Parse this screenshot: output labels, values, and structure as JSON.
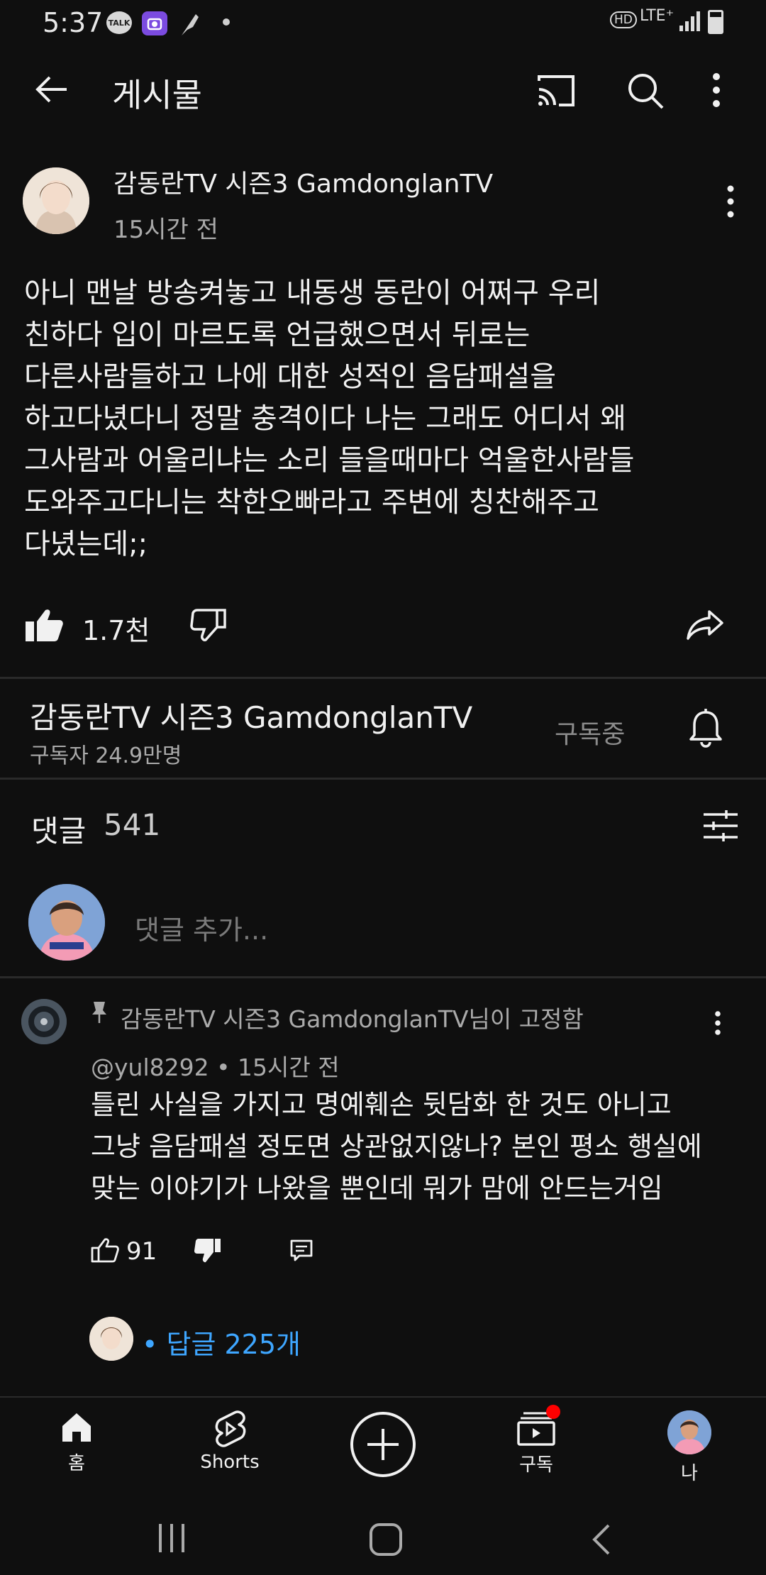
{
  "status_bar": {
    "time": "5:37",
    "talk_badge": "TALK",
    "hd": "HD",
    "network": "LTE⁺"
  },
  "top_bar": {
    "title": "게시물",
    "icons": [
      "back-arrow-icon",
      "cast-icon",
      "search-icon",
      "more-vertical-icon"
    ]
  },
  "post": {
    "channel": "감동란TV 시즌3 GamdonglanTV",
    "time": "15시간 전",
    "body": "아니 맨날 방송켜놓고 내동생 동란이 어쩌구 우리\n친하다 입이 마르도록 언급했으면서 뒤로는\n다른사람들하고 나에 대한 성적인 음담패설을\n하고다녔다니 정말 충격이다 나는 그래도 어디서 왜\n그사람과 어울리냐는 소리 들을때마다 억울한사람들\n도와주고다니는 착한오빠라고 주변에 칭찬해주고\n다녔는데;;",
    "likes": "1.7천"
  },
  "subscription": {
    "channel": "감동란TV 시즌3 GamdonglanTV",
    "subscribers": "구독자 24.9만명",
    "state": "구독중"
  },
  "comments": {
    "label": "댓글",
    "count": "541",
    "input_placeholder": "댓글 추가...",
    "pinned": {
      "pinned_by": "감동란TV 시즌3 GamdonglanTV님이 고정함",
      "handle_time": "@yul8292 • 15시간 전",
      "body": "틀린 사실을 가지고 명예훼손 뒷담화 한 것도 아니고\n그냥 음담패설 정도면 상관없지않나? 본인 평소 행실에\n맞는 이야기가 나왔을 뿐인데 뭐가 맘에 안드는거임",
      "likes": "91",
      "replies": "• 답글 225개"
    }
  },
  "bottom_nav": {
    "home": "홈",
    "shorts": "Shorts",
    "subscriptions": "구독",
    "me": "나"
  },
  "colors": {
    "background": "#0f0f0f",
    "link": "#3ea6ff",
    "notification_dot": "#ff0000"
  }
}
